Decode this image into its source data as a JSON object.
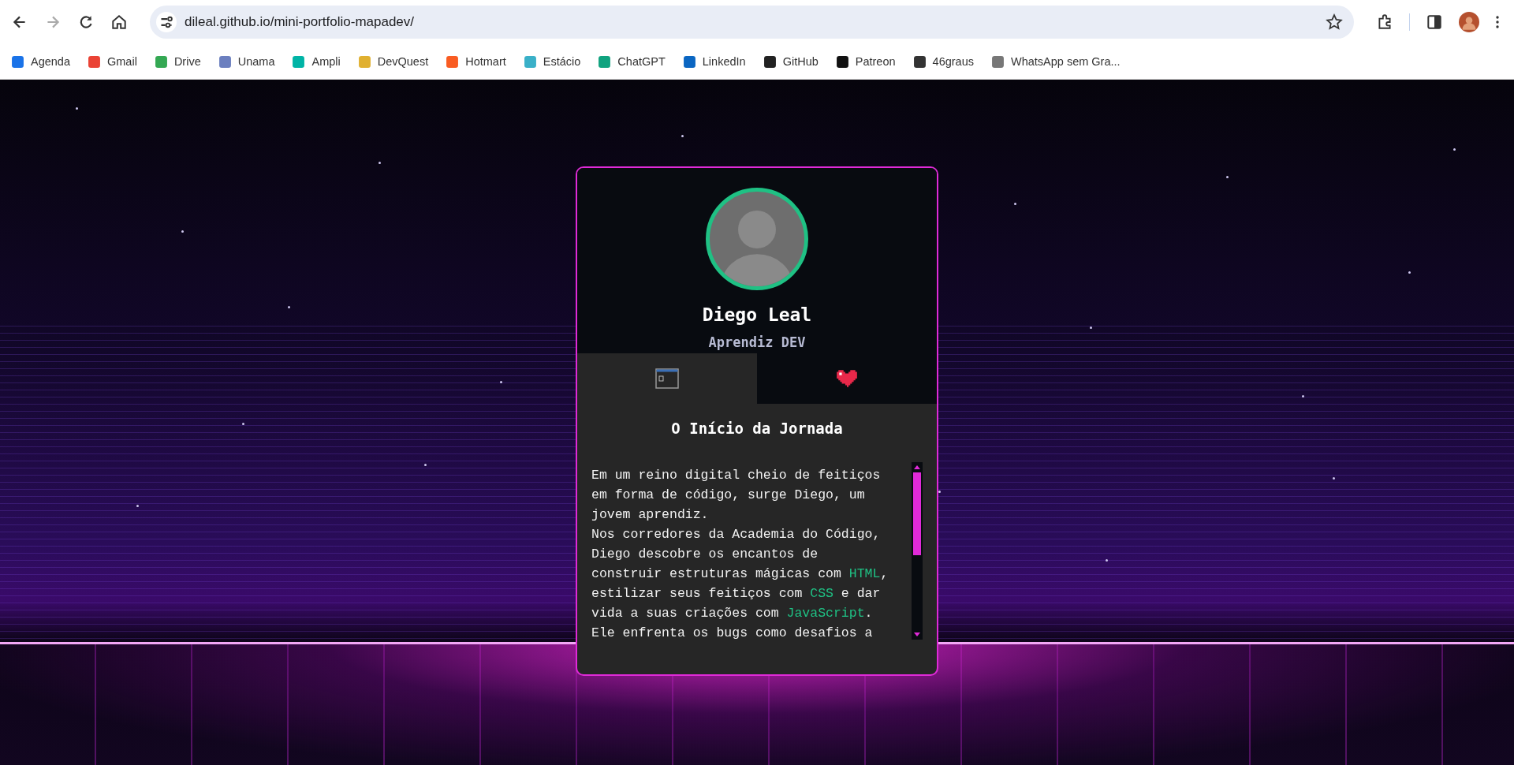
{
  "browser": {
    "url": "dileal.github.io/mini-portfolio-mapadev/",
    "forward_disabled": true
  },
  "bookmarks": [
    {
      "label": "Agenda"
    },
    {
      "label": "Gmail"
    },
    {
      "label": "Drive"
    },
    {
      "label": "Unama"
    },
    {
      "label": "Ampli"
    },
    {
      "label": "DevQuest"
    },
    {
      "label": "Hotmart"
    },
    {
      "label": "Estácio"
    },
    {
      "label": "ChatGPT"
    },
    {
      "label": "LinkedIn"
    },
    {
      "label": "GitHub"
    },
    {
      "label": "Patreon"
    },
    {
      "label": "46graus"
    },
    {
      "label": "WhatsApp sem Gra..."
    }
  ],
  "profile": {
    "name": "Diego Leal",
    "role": "Aprendiz DEV"
  },
  "tabs": [
    {
      "kind": "window",
      "selected": true
    },
    {
      "kind": "heart",
      "selected": false
    }
  ],
  "story": {
    "title": "O Início da Jornada",
    "lines": [
      [
        {
          "text": "Em um reino digital cheio de feitiços",
          "highlight": false
        }
      ],
      [
        {
          "text": "em forma de código, surge Diego, um",
          "highlight": false
        }
      ],
      [
        {
          "text": "jovem aprendiz.",
          "highlight": false
        }
      ],
      [
        {
          "text": "Nos corredores da Academia do Código,",
          "highlight": false
        }
      ],
      [
        {
          "text": "Diego descobre os encantos de",
          "highlight": false
        }
      ],
      [
        {
          "text": "construir estruturas mágicas com ",
          "highlight": false
        },
        {
          "text": "HTML",
          "highlight": true
        },
        {
          "text": ",",
          "highlight": false
        }
      ],
      [
        {
          "text": "estilizar seus feitiços com ",
          "highlight": false
        },
        {
          "text": "CSS",
          "highlight": true
        },
        {
          "text": " e dar",
          "highlight": false
        }
      ],
      [
        {
          "text": "vida a suas criações com ",
          "highlight": false
        },
        {
          "text": "JavaScript",
          "highlight": true
        },
        {
          "text": ".",
          "highlight": false
        }
      ],
      [
        {
          "text": "Ele enfrenta os bugs como desafios a",
          "highlight": false
        }
      ]
    ]
  }
}
